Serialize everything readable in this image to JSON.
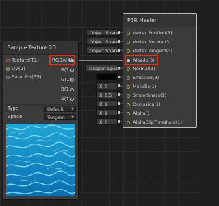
{
  "sample_texture": {
    "title": "Sample Texture 2D",
    "inputs": [
      {
        "label": "Texture(T2)",
        "color": "#d46060"
      },
      {
        "label": "UV(2)",
        "color": "#8fd45e"
      },
      {
        "label": "Sampler(SS)",
        "color": "#9a9a9a"
      }
    ],
    "outputs": [
      "RGBA(4)",
      "R(1)",
      "G(1)",
      "B(1)",
      "A(1)"
    ],
    "type_label": "Type",
    "type_value": "Default",
    "space_label": "Space",
    "space_value": "Tangent"
  },
  "master": {
    "title": "PBR Master",
    "inputs": [
      "Vertex Position(3)",
      "Vertex Normal(3)",
      "Vertex Tangent(3)",
      "Albedo(3)",
      "Normal(3)",
      "Emission(3)",
      "Metallic(1)",
      "Smoothness(1)",
      "Occlusion(1)",
      "Alpha(1)",
      "AlphaClipThreshold(1)"
    ]
  },
  "chips": {
    "pos": "Object Space",
    "normal": "Object Space",
    "tangent": "Object Space",
    "normal_map": "Tangent Space",
    "metallic_x": "X",
    "metallic_v": "0",
    "smooth_x": "X",
    "smooth_v": "0.5",
    "occl_x": "X",
    "occl_v": "1",
    "alpha_x": "X",
    "alpha_v": "1",
    "clip_x": "X",
    "clip_v": "0"
  },
  "colors": {
    "highlight": "#e0301e",
    "master_border": "#8fc8f0"
  }
}
